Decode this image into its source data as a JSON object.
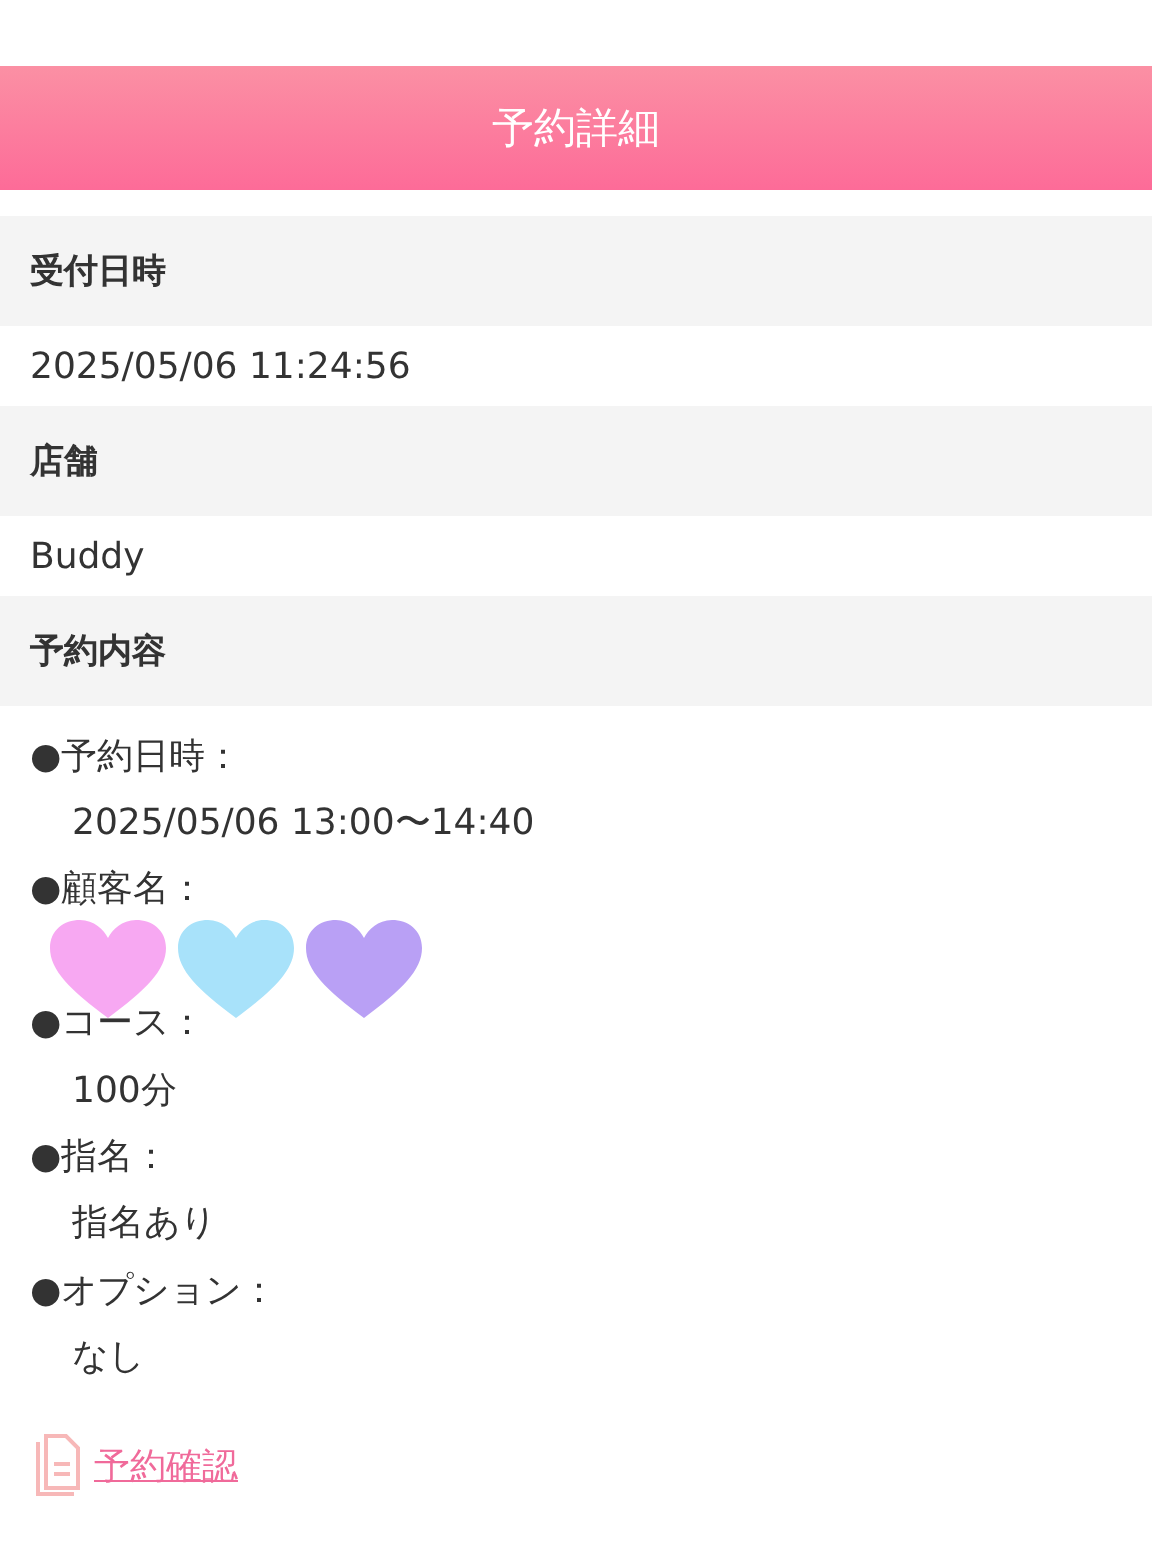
{
  "header": {
    "title": "予約詳細"
  },
  "sections": [
    {
      "label": "受付日時",
      "value": "2025/05/06 11:24:56"
    },
    {
      "label": "店舗",
      "value": "Buddy"
    }
  ],
  "details": {
    "label": "予約内容",
    "items": [
      {
        "kind": "text",
        "label": "●予約日時：",
        "value": "2025/05/06 13:00〜14:40"
      },
      {
        "kind": "hidden",
        "label": "●顧客名：",
        "hearts": [
          {
            "color": "#f7a8f2"
          },
          {
            "color": "#a8e2fa"
          },
          {
            "color": "#b9a0f5"
          }
        ]
      },
      {
        "kind": "text",
        "label": "●コース：",
        "value": "100分"
      },
      {
        "kind": "text",
        "label": "●指名：",
        "value": "指名あり"
      },
      {
        "kind": "text",
        "label": "●オプション：",
        "value": "なし"
      }
    ]
  },
  "link": {
    "label": "予約確認"
  }
}
